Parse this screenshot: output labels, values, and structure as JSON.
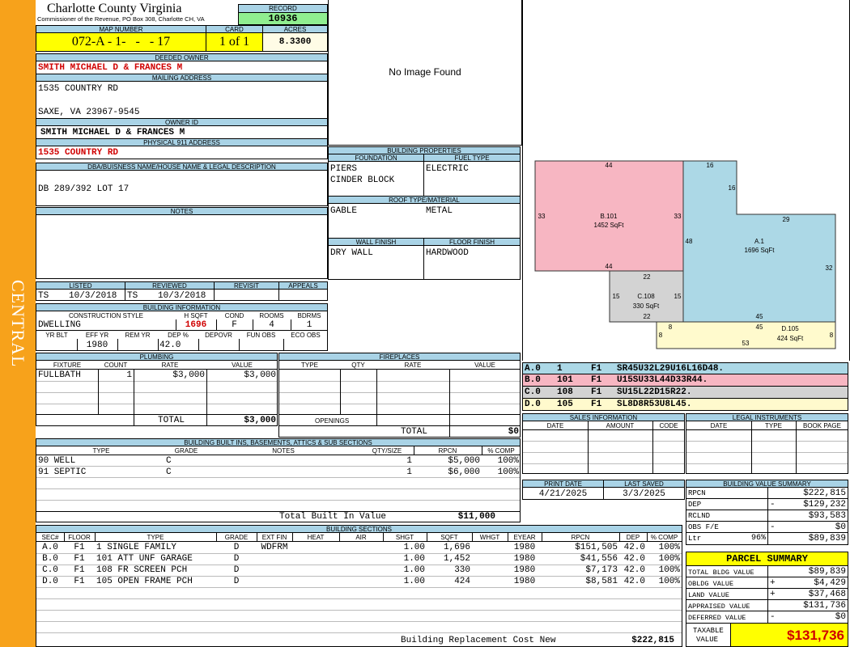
{
  "sidebar": {
    "district": "CENTRAL"
  },
  "header": {
    "county": "Charlotte County Virginia",
    "office": "Commissioner of the Revenue, PO Box 308, Charlotte CH, VA",
    "record_label": "RECORD",
    "record": "10936"
  },
  "parcel": {
    "map_label": "MAP NUMBER",
    "map_number": "072-A - 1-   -   - 17",
    "card_label": "CARD",
    "card": "1 of 1",
    "acres_label": "ACRES",
    "acres": "8.3300"
  },
  "owner": {
    "deeded_label": "DEEDED OWNER",
    "deeded_owner": "SMITH MICHAEL D & FRANCES M",
    "mailing_label": "MAILING ADDRESS",
    "mailing_line1": "1535 COUNTRY RD",
    "mailing_line2": "SAXE, VA 23967-9545",
    "owner_id_label": "OWNER ID",
    "owner_id": "SMITH MICHAEL D & FRANCES M",
    "phys_label": "PHYSICAL 911 ADDRESS",
    "phys_address": "1535 COUNTRY RD"
  },
  "legal": {
    "label": "DBA/BUISNESS NAME/HOUSE NAME & LEGAL DESCRIPTION",
    "text": "DB 289/392 LOT 17"
  },
  "notes": {
    "label": "NOTES"
  },
  "photo": {
    "text": "No Image Found"
  },
  "dates": {
    "listed_label": "LISTED",
    "reviewed_label": "REVIEWED",
    "revisit_label": "REVISIT",
    "appeals_label": "APPEALS",
    "listed_by": "TS",
    "listed_date": "10/3/2018",
    "reviewed_by": "TS",
    "reviewed_date": "10/3/2018"
  },
  "building_info": {
    "label": "BUILDING INFORMATION",
    "h": [
      "CONSTRUCTION STYLE",
      "H SQFT",
      "COND",
      "ROOMS",
      "BDRMS"
    ],
    "style": "DWELLING",
    "hsqft": "1696",
    "cond": "F",
    "rooms": "4",
    "bdrms": "1",
    "h2": [
      "YR BLT",
      "EFF YR",
      "REM YR",
      "DEP %",
      "DEPOVR",
      "FUN OBS",
      "ECO OBS"
    ],
    "eff_yr": "1980",
    "dep": "42.0"
  },
  "props": {
    "label": "BUILDING PROPERTIES",
    "foundation_label": "FOUNDATION",
    "fuel_label": "FUEL TYPE",
    "foundation1": "PIERS",
    "foundation2": "CINDER BLOCK",
    "fuel": "ELECTRIC",
    "roof_label": "ROOF TYPE/MATERIAL",
    "roof_type": "GABLE",
    "roof_mat": "METAL",
    "wall_label": "WALL FINISH",
    "floor_label": "FLOOR FINISH",
    "wall": "DRY WALL",
    "floor": "HARDWOOD"
  },
  "sketch": {
    "areas": [
      {
        "name": "B.101",
        "sqft": "1452 SqFt",
        "color": "#f7b6c2"
      },
      {
        "name": "A.1",
        "sqft": "1696 SqFt",
        "color": "#acd8e6"
      },
      {
        "name": "C.108",
        "sqft": "330 SqFt",
        "color": "#d3d3d3"
      },
      {
        "name": "D.105",
        "sqft": "424 SqFt",
        "color": "#fffacd"
      }
    ],
    "dims": [
      "44",
      "16",
      "16",
      "33",
      "33",
      "29",
      "48",
      "32",
      "44",
      "22",
      "15",
      "15",
      "22",
      "45",
      "8",
      "45",
      "8",
      "53",
      "8"
    ]
  },
  "legend": [
    {
      "c1": "A.0",
      "c2": "1",
      "c3": "F1",
      "c4": "SR45U32L29U16L16D48.",
      "color": "#acd8e6"
    },
    {
      "c1": "B.0",
      "c2": "101",
      "c3": "F1",
      "c4": "U15SU33L44D33R44.",
      "color": "#f7b6c2"
    },
    {
      "c1": "C.0",
      "c2": "108",
      "c3": "F1",
      "c4": "SU15L22D15R22.",
      "color": "#d3d3d3"
    },
    {
      "c1": "D.0",
      "c2": "105",
      "c3": "F1",
      "c4": "SL8D8R53U8L45.",
      "color": "#fffacd"
    }
  ],
  "plumbing": {
    "label": "PLUMBING",
    "h": [
      "FIXTURE",
      "COUNT",
      "RATE",
      "VALUE"
    ],
    "rows": [
      {
        "fixture": "FULLBATH",
        "count": "1",
        "rate": "$3,000",
        "value": "$3,000"
      }
    ],
    "total_label": "TOTAL",
    "total": "$3,000"
  },
  "fireplaces": {
    "label": "FIREPLACES",
    "h": [
      "TYPE",
      "QTY",
      "RATE",
      "VALUE"
    ],
    "openings_label": "OPENINGS",
    "total_label": "TOTAL",
    "total": "$0"
  },
  "sales": {
    "label": "SALES INFORMATION",
    "h": [
      "DATE",
      "AMOUNT",
      "CODE"
    ]
  },
  "legal_instr": {
    "label": "LEGAL INSTRUMENTS",
    "h": [
      "DATE",
      "TYPE",
      "BOOK PAGE"
    ]
  },
  "builtins": {
    "label": "BUILDING BUILT INS, BASEMENTS, ATTICS & SUB SECTIONS",
    "h": [
      "TYPE",
      "GRADE",
      "NOTES",
      "QTY/SIZE",
      "RPCN",
      "% COMP"
    ],
    "rows": [
      {
        "type": "90 WELL",
        "grade": "C",
        "qty": "1",
        "rpcn": "$5,000",
        "comp": "100%"
      },
      {
        "type": "91 SEPTIC",
        "grade": "C",
        "qty": "1",
        "rpcn": "$6,000",
        "comp": "100%"
      }
    ],
    "total_label": "Total Built In Value",
    "total": "$11,000"
  },
  "print": {
    "print_label": "PRINT DATE",
    "saved_label": "LAST SAVED",
    "print_date": "4/21/2025",
    "last_saved": "3/3/2025"
  },
  "value_summary": {
    "label": "BUILDING VALUE SUMMARY",
    "rows": [
      {
        "l": "RPCN",
        "s": "",
        "v": "$222,815"
      },
      {
        "l": "DEP",
        "s": "-",
        "v": "$129,232"
      },
      {
        "l": "RCLND",
        "s": "",
        "v": "$93,583"
      },
      {
        "l": "OBS F/E",
        "s": "-",
        "v": "$0"
      },
      {
        "l": "Ltr",
        "p": "96%",
        "s": "",
        "v": "$89,839"
      }
    ]
  },
  "parcel_summary": {
    "label": "PARCEL SUMMARY",
    "rows": [
      {
        "l": "TOTAL BLDG VALUE",
        "s": "",
        "v": "$89,839"
      },
      {
        "l": "OBLDG VALUE",
        "s": "+",
        "v": "$4,429"
      },
      {
        "l": "LAND VALUE",
        "s": "+",
        "v": "$37,468"
      },
      {
        "l": "APPRAISED VALUE",
        "s": "",
        "v": "$131,736"
      },
      {
        "l": "DEFERRED VALUE",
        "s": "-",
        "v": "$0"
      }
    ],
    "taxable_label1": "TAXABLE",
    "taxable_label2": "VALUE",
    "taxable": "$131,736"
  },
  "sections": {
    "label": "BUILDING SECTIONS",
    "h": [
      "SEC#",
      "FLOOR",
      "TYPE",
      "GRADE",
      "EXT FIN",
      "HEAT",
      "AIR",
      "SHGT",
      "SQFT",
      "WHGT",
      "EYEAR",
      "RPCN",
      "DEP",
      "% COMP"
    ],
    "rows": [
      {
        "sec": "A.0",
        "floor": "F1",
        "type": "1 SINGLE FAMILY",
        "grade": "D",
        "ext": "WDFRM",
        "shgt": "1.00",
        "sqft": "1,696",
        "eyear": "1980",
        "rpcn": "$151,505",
        "dep": "42.0",
        "comp": "100%"
      },
      {
        "sec": "B.0",
        "floor": "F1",
        "type": "101 ATT UNF GARAGE",
        "grade": "D",
        "ext": "",
        "shgt": "1.00",
        "sqft": "1,452",
        "eyear": "1980",
        "rpcn": "$41,556",
        "dep": "42.0",
        "comp": "100%"
      },
      {
        "sec": "C.0",
        "floor": "F1",
        "type": "108 FR SCREEN PCH",
        "grade": "D",
        "ext": "",
        "shgt": "1.00",
        "sqft": "330",
        "eyear": "1980",
        "rpcn": "$7,173",
        "dep": "42.0",
        "comp": "100%"
      },
      {
        "sec": "D.0",
        "floor": "F1",
        "type": "105 OPEN FRAME PCH",
        "grade": "D",
        "ext": "",
        "shgt": "1.00",
        "sqft": "424",
        "eyear": "1980",
        "rpcn": "$8,581",
        "dep": "42.0",
        "comp": "100%"
      }
    ],
    "total_label": "Building Replacement Cost New",
    "total": "$222,815"
  }
}
